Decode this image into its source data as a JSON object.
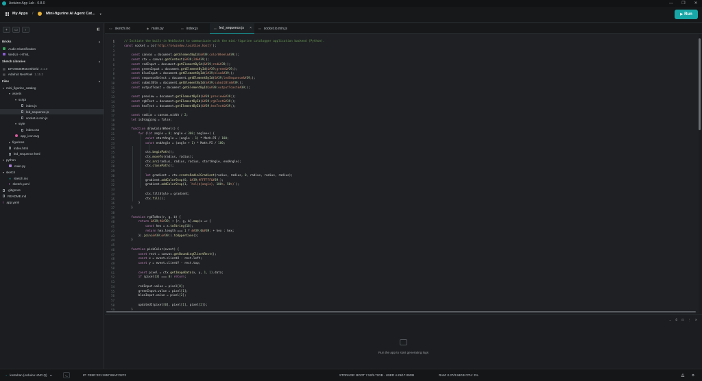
{
  "window": {
    "title": "Arduino App Lab - 0.8.0",
    "controls": [
      "—",
      "❐",
      "✕"
    ]
  },
  "header": {
    "my_apps": "My Apps",
    "separator": "/",
    "project_name": "Mini-figurine AI Agent Cat...",
    "run_label": "Run"
  },
  "sidebar": {
    "bricks_title": "Bricks",
    "bricks": [
      {
        "label": "Audio Classification",
        "color": "#3aa35b"
      },
      {
        "label": "WebUI - HTML",
        "color": "#8e5bd6"
      }
    ],
    "libraries_title": "Sketch Libraries",
    "libraries": [
      {
        "label": "DRV8835MotorShield",
        "version": "2.1.0"
      },
      {
        "label": "Adafruit NeoPixel",
        "version": "1.15.2"
      }
    ],
    "files_title": "Files",
    "files": [
      {
        "label": "mini_figurine_catalog",
        "indent": 0,
        "type": "folder",
        "open": true
      },
      {
        "label": "assets",
        "indent": 1,
        "type": "folder",
        "open": true
      },
      {
        "label": "script",
        "indent": 2,
        "type": "folder",
        "open": true
      },
      {
        "label": "index.js",
        "indent": 3,
        "type": "file"
      },
      {
        "label": "led_sequence.js",
        "indent": 3,
        "type": "file",
        "selected": true
      },
      {
        "label": "socket.io.min.js",
        "indent": 3,
        "type": "file"
      },
      {
        "label": "style",
        "indent": 2,
        "type": "folder",
        "open": true
      },
      {
        "label": "index.css",
        "indent": 3,
        "type": "file"
      },
      {
        "label": "app_icon.svg",
        "indent": 2,
        "type": "svg"
      },
      {
        "label": "figurines",
        "indent": 1,
        "type": "folder",
        "open": false
      },
      {
        "label": "index.html",
        "indent": 1,
        "type": "file"
      },
      {
        "label": "led_sequence.html",
        "indent": 1,
        "type": "file"
      },
      {
        "label": "python",
        "indent": 0,
        "type": "folder",
        "open": true
      },
      {
        "label": "main.py",
        "indent": 1,
        "type": "python"
      },
      {
        "label": "sketch",
        "indent": 0,
        "type": "folder",
        "open": true
      },
      {
        "label": "sketch.ino",
        "indent": 1,
        "type": "ino"
      },
      {
        "label": "sketch.yaml",
        "indent": 1,
        "type": "yaml"
      },
      {
        "label": ".gitignore",
        "indent": 0,
        "type": "file"
      },
      {
        "label": "README.md",
        "indent": 0,
        "type": "file"
      },
      {
        "label": "app.yaml",
        "indent": 0,
        "type": "yaml"
      }
    ]
  },
  "tabs": [
    {
      "label": "sketch.ino",
      "icon": "<>"
    },
    {
      "label": "main.py",
      "icon": "◆"
    },
    {
      "label": "index.js",
      "icon": "▭"
    },
    {
      "label": "led_sequence.js",
      "icon": "▭",
      "active": true,
      "close": "×"
    },
    {
      "label": "socket.io.min.js",
      "icon": "▭"
    }
  ],
  "code_lines": [
    "// Initiate the built-in WebSocket to communicate with the mini-figurine catalogger application backend (Python).",
    "const socket = io(`http://${window.location.host}`);",
    "",
    "    const canvas = document.getElementById('colorWheel');",
    "    const ctx = canvas.getContext('2d');",
    "    const redInput = document.getElementById('red');",
    "    const greenInput = document.getElementById('green');",
    "    const blueInput = document.getElementById('blue');",
    "    const sequenceSelect = document.getElementById('ledSequence');",
    "    const submitBtn = document.getElementById('submitBtn');",
    "    const outputToast = document.getElementById('outputToast');",
    "",
    "    const preview = document.getElementById('preview');",
    "    const rgbText = document.getElementById('rgbText');",
    "    const hexText = document.getElementById('hexText');",
    "",
    "    const radius = canvas.width / 2;",
    "    let isDragging = false;",
    "",
    "    function drawColorWheel() {",
    "        for (let angle = 0; angle < 360; angle++) {",
    "            const startAngle = (angle - 1) * Math.PI / 180;",
    "            const endAngle = (angle + 1) * Math.PI / 180;",
    "",
    "            ctx.beginPath();",
    "            ctx.moveTo(radius, radius);",
    "            ctx.arc(radius, radius, radius, startAngle, endAngle);",
    "            ctx.closePath();",
    "",
    "            let gradient = ctx.createRadialGradient(radius, radius, 0, radius, radius, radius);",
    "            gradient.addColorStop(0, '#FFFFFF');",
    "            gradient.addColorStop(1, `hsl(${angle}, 100%, 50%)`);",
    "",
    "            ctx.fillStyle = gradient;",
    "            ctx.fill();",
    "        }",
    "    }",
    "",
    "    function rgbToHex(r, g, b) {",
    "        return '#' + [r, g, b].map(x => {",
    "            const hex = x.toString(16);",
    "            return hex.length === 1 ? '0' + hex : hex;",
    "        }).join('').toUpperCase();",
    "    }",
    "",
    "    function pickColor(event) {",
    "        const rect = canvas.getBoundingClientRect();",
    "        const x = event.clientX - rect.left;",
    "        const y = event.clientY - rect.top;",
    "",
    "        const pixel = ctx.getImageData(x, y, 1, 1).data;",
    "        if (pixel[3] === 0) return;",
    "",
    "        redInput.value = pixel[0];",
    "        greenInput.value = pixel[1];",
    "        blueInput.value = pixel[2];",
    "",
    "        updateUI(pixel[0], pixel[1], pixel[2]);",
    "    }"
  ],
  "logs": {
    "controls": [
      "⌄",
      "⏱",
      "⊡",
      "⋮",
      "✕"
    ],
    "empty_message": "Run the app to start generating logs"
  },
  "status": {
    "board": "kostuhan (Arduino UNO Q)",
    "ip": "IP: FE80::321:1857:69AF:D2F2",
    "storage": "STORAGE: BOOT 7.52/9.72GB · USER 4.29/17.09GB",
    "ram": "RAM: 0.37/3.58GB",
    "cpu": "CPU: 3%"
  }
}
